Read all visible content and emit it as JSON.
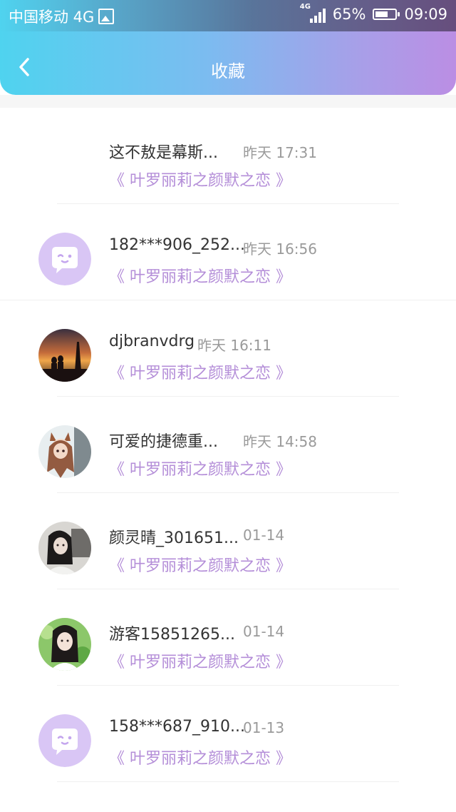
{
  "status_bar": {
    "carrier": "中国移动 4G",
    "network_tag": "4G",
    "battery_percent": "65%",
    "battery_level": 0.65,
    "time": "09:09"
  },
  "nav": {
    "title": "收藏"
  },
  "colors": {
    "header_gradient_start": "#4fd3ef",
    "header_gradient_end": "#bb8ee4",
    "book_title": "#b48ed8",
    "name_text": "#333333",
    "time_text": "#9a9a9a",
    "default_avatar_bg": "#d9c6f5"
  },
  "items": [
    {
      "name": "这不敖是幕斯...",
      "time": "昨天 17:31",
      "book": "《 叶罗丽莉之颜默之恋 》",
      "avatar": "none"
    },
    {
      "name": "182***906_252...",
      "time": "昨天 16:56",
      "book": "《 叶罗丽莉之颜默之恋 》",
      "avatar": "default-chat-avatar"
    },
    {
      "name": "djbranvdrg",
      "time": "昨天 16:11",
      "book": "《 叶罗丽莉之颜默之恋 》",
      "avatar": "photo-sunset-couple"
    },
    {
      "name": "可爱的捷德重...",
      "time": "昨天 14:58",
      "book": "《 叶罗丽莉之颜默之恋 》",
      "avatar": "photo-anime-girl"
    },
    {
      "name": "颜灵晴_301651...",
      "time": "01-14",
      "book": "《 叶罗丽莉之颜默之恋 》",
      "avatar": "photo-girl-bw"
    },
    {
      "name": "游客15851265...",
      "time": "01-14",
      "book": "《 叶罗丽莉之颜默之恋 》",
      "avatar": "photo-girl-green"
    },
    {
      "name": "158***687_910...",
      "time": "01-13",
      "book": "《 叶罗丽莉之颜默之恋 》",
      "avatar": "default-chat-avatar"
    }
  ]
}
